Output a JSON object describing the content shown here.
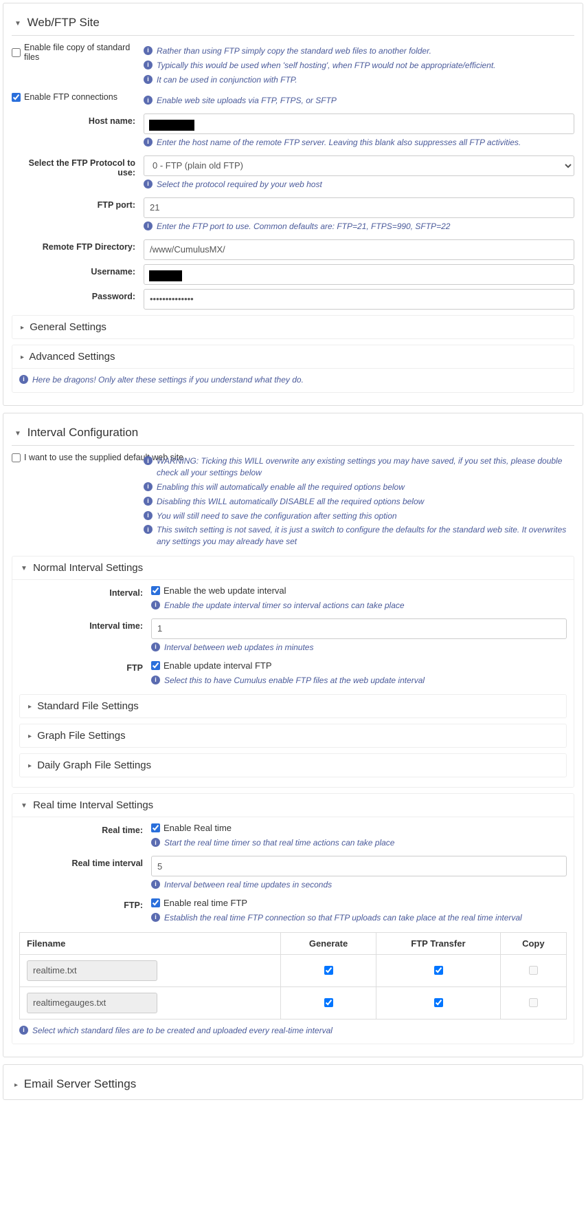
{
  "webftp": {
    "title": "Web/FTP Site",
    "enable_copy_label": "Enable file copy of standard files",
    "enable_copy": false,
    "copy_help": [
      "Rather than using FTP simply copy the standard web files to another folder.",
      "Typically this would be used when 'self hosting', when FTP would not be appropriate/efficient.",
      "It can be used in conjunction with FTP."
    ],
    "enable_ftp_label": "Enable FTP connections",
    "enable_ftp": true,
    "enable_ftp_help": "Enable web site uploads via FTP, FTPS, or SFTP",
    "host_label": "Host name:",
    "host_help": "Enter the host name of the remote FTP server. Leaving this blank also suppresses all FTP activities.",
    "proto_label": "Select the FTP Protocol to use:",
    "proto_value": "0 - FTP (plain old FTP)",
    "proto_help": "Select the protocol required by your web host",
    "port_label": "FTP port:",
    "port_value": "21",
    "port_help": "Enter the FTP port to use. Common defaults are: FTP=21, FTPS=990, SFTP=22",
    "dir_label": "Remote FTP Directory:",
    "dir_value": "/www/CumulusMX/",
    "user_label": "Username:",
    "pass_label": "Password:",
    "pass_value": "••••••••••••••",
    "general_title": "General Settings",
    "advanced_title": "Advanced Settings",
    "advanced_help": "Here be dragons! Only alter these settings if you understand what they do."
  },
  "interval": {
    "title": "Interval Configuration",
    "default_label": "I want to use the supplied default web site",
    "default_checked": false,
    "default_help": [
      "WARNING: Ticking this WILL overwrite any existing settings you may have saved, if you set this, please double check all your settings below",
      "Enabling this will automatically enable all the required options below",
      "Disabling this WILL automatically DISABLE all the required options below",
      "You will still need to save the configuration after setting this option",
      "This switch setting is not saved, it is just a switch to configure the defaults for the standard web site. It overwrites any settings you may already have set"
    ],
    "normal": {
      "title": "Normal Interval Settings",
      "int_label": "Interval:",
      "int_cb_label": "Enable the web update interval",
      "int_cb": true,
      "int_help": "Enable the update interval timer so interval actions can take place",
      "time_label": "Interval time:",
      "time_value": "1",
      "time_help": "Interval between web updates in minutes",
      "ftp_label": "FTP",
      "ftp_cb_label": "Enable update interval FTP",
      "ftp_cb": true,
      "ftp_help": "Select this to have Cumulus enable FTP files at the web update interval",
      "std_title": "Standard File Settings",
      "graph_title": "Graph File Settings",
      "dgraph_title": "Daily Graph File Settings"
    },
    "realtime": {
      "title": "Real time Interval Settings",
      "rt_label": "Real time:",
      "rt_cb_label": "Enable Real time",
      "rt_cb": true,
      "rt_help": "Start the real time timer so that real time actions can take place",
      "rti_label": "Real time interval",
      "rti_value": "5",
      "rti_help": "Interval between real time updates in seconds",
      "ftp_label": "FTP:",
      "ftp_cb_label": "Enable real time FTP",
      "ftp_cb": true,
      "ftp_help": "Establish the real time FTP connection so that FTP uploads can take place at the real time interval",
      "table_headers": [
        "Filename",
        "Generate",
        "FTP Transfer",
        "Copy"
      ],
      "rows": [
        {
          "fn": "realtime.txt",
          "gen": true,
          "ftp": true,
          "copy": false
        },
        {
          "fn": "realtimegauges.txt",
          "gen": true,
          "ftp": true,
          "copy": false
        }
      ],
      "table_help": "Select which standard files are to be created and uploaded every real-time interval"
    }
  },
  "email": {
    "title": "Email Server Settings"
  }
}
